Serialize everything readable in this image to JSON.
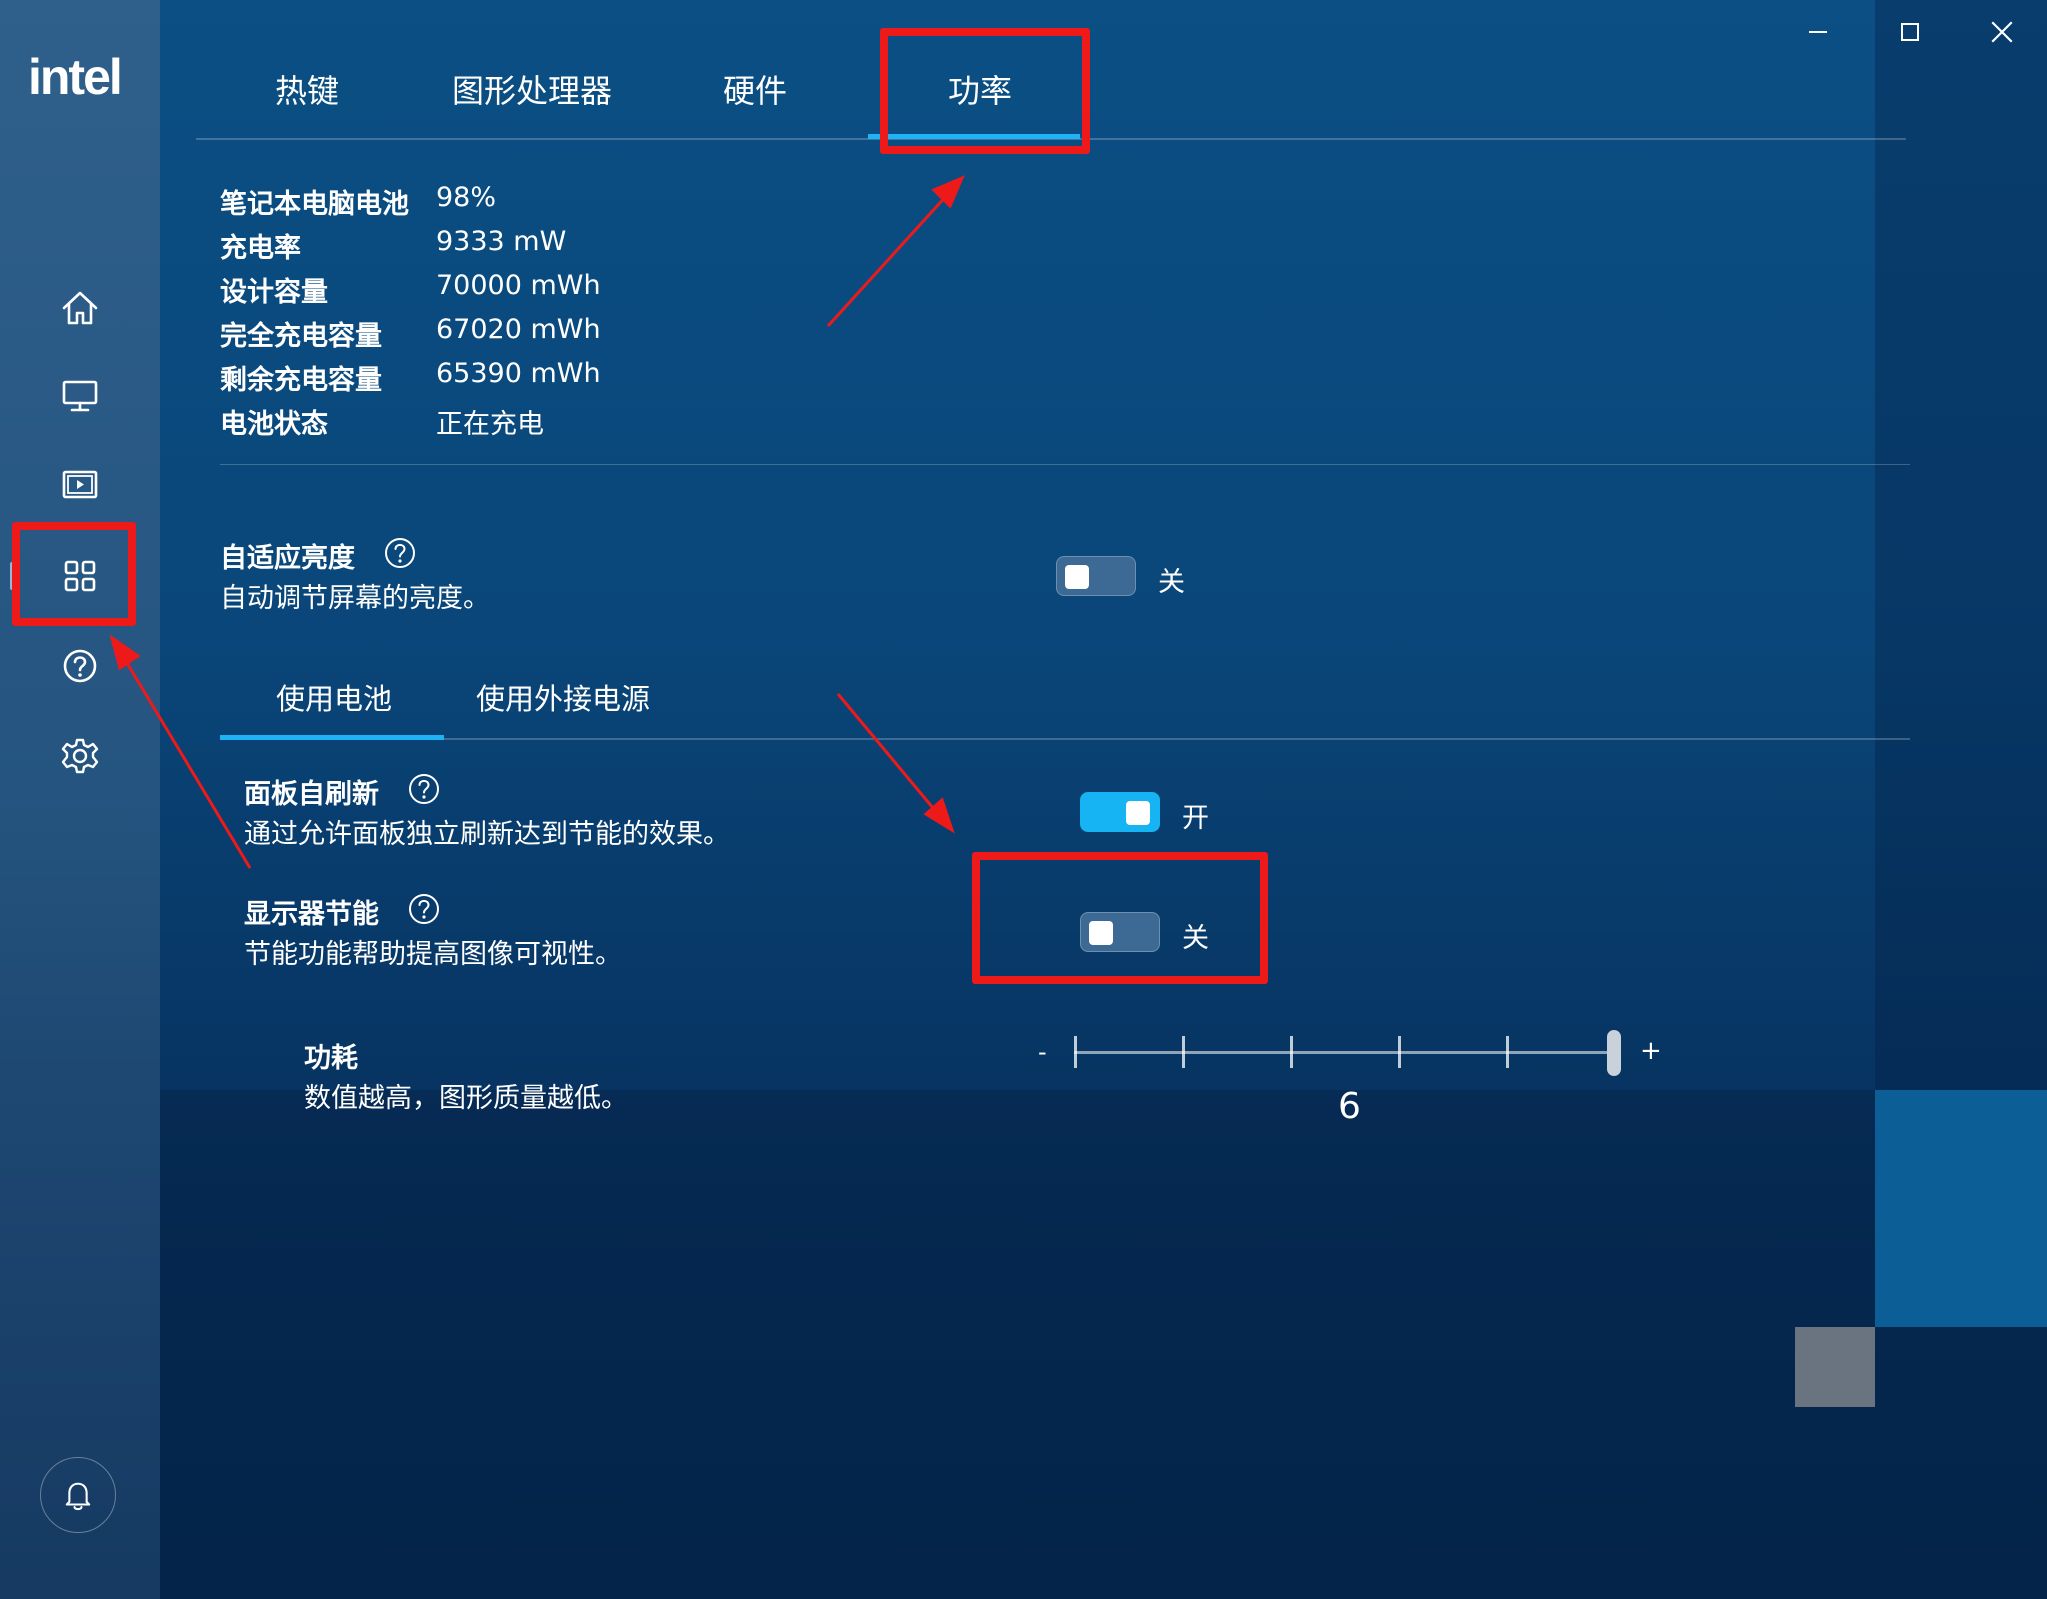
{
  "app": {
    "logo": "intel",
    "window_controls": {
      "minimize": "minimize",
      "maximize": "maximize",
      "close": "close"
    }
  },
  "sidebar": {
    "items": [
      {
        "id": "home",
        "icon": "home-icon"
      },
      {
        "id": "display",
        "icon": "monitor-icon"
      },
      {
        "id": "video",
        "icon": "video-icon"
      },
      {
        "id": "system",
        "icon": "grid-icon"
      },
      {
        "id": "help",
        "icon": "help-icon"
      },
      {
        "id": "settings",
        "icon": "gear-icon"
      }
    ],
    "notifications_icon": "bell-icon"
  },
  "tabs": [
    {
      "label": "热键"
    },
    {
      "label": "图形处理器"
    },
    {
      "label": "硬件"
    },
    {
      "label": "功率"
    }
  ],
  "battery_info": [
    {
      "label": "笔记本电脑电池",
      "value": "98%"
    },
    {
      "label": "充电率",
      "value": "9333 mW"
    },
    {
      "label": "设计容量",
      "value": "70000 mWh"
    },
    {
      "label": "完全充电容量",
      "value": "67020 mWh"
    },
    {
      "label": "剩余充电容量",
      "value": "65390 mWh"
    },
    {
      "label": "电池状态",
      "value": "正在充电"
    }
  ],
  "adaptive_brightness": {
    "title": "自适应亮度",
    "description": "自动调节屏幕的亮度。",
    "state": "关"
  },
  "power_source_tabs": [
    {
      "label": "使用电池"
    },
    {
      "label": "使用外接电源"
    }
  ],
  "panel_self_refresh": {
    "title": "面板自刷新",
    "description": "通过允许面板独立刷新达到节能的效果。",
    "state": "开"
  },
  "display_power_saving": {
    "title": "显示器节能",
    "description": "节能功能帮助提高图像可视性。",
    "state": "关"
  },
  "power_consumption": {
    "title": "功耗",
    "description": "数值越高，图形质量越低。",
    "min_label": "-",
    "max_label": "+",
    "value": "6",
    "value_num": 6,
    "min": 1,
    "max": 6
  },
  "colors": {
    "accent": "#1fb3f5",
    "annotation": "#ee1a1a",
    "background": "#0a4679"
  }
}
